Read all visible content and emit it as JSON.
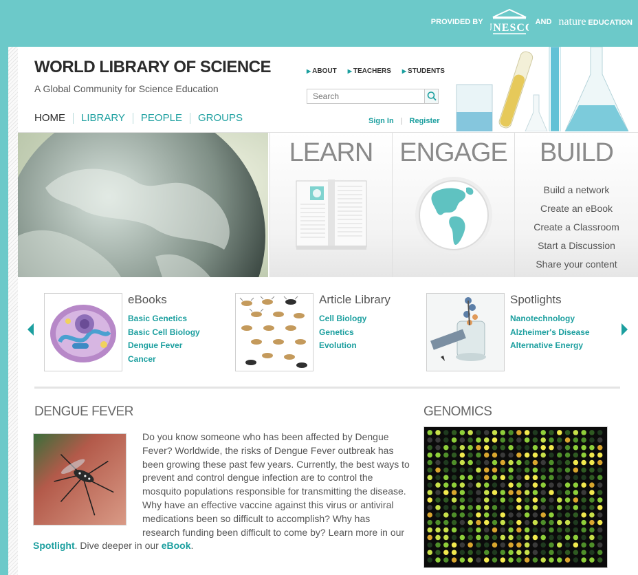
{
  "header": {
    "provided_by": "PROVIDED BY",
    "unesco": "UNESCO",
    "and": "AND",
    "nature": "nature",
    "education": "EDUCATION"
  },
  "site": {
    "title": "WORLD LIBRARY OF SCIENCE",
    "subtitle": "A Global Community for Science Education"
  },
  "nav": {
    "main": [
      "HOME",
      "LIBRARY",
      "PEOPLE",
      "GROUPS"
    ],
    "utility": [
      "ABOUT",
      "TEACHERS",
      "STUDENTS"
    ]
  },
  "search": {
    "placeholder": "Search"
  },
  "auth": {
    "sign_in": "Sign In",
    "register": "Register"
  },
  "hero": {
    "learn": "LEARN",
    "engage": "ENGAGE",
    "build": "BUILD",
    "build_items": [
      "Build a network",
      "Create an eBook",
      "Create a Classroom",
      "Start a Discussion",
      "Share your content"
    ]
  },
  "carousel": {
    "ebooks": {
      "title": "eBooks",
      "items": [
        "Basic Genetics",
        "Basic Cell Biology",
        "Dengue Fever",
        "Cancer"
      ]
    },
    "articles": {
      "title": "Article Library",
      "items": [
        "Cell Biology",
        "Genetics",
        "Evolution"
      ]
    },
    "spotlights": {
      "title": "Spotlights",
      "items": [
        "Nanotechnology",
        "Alzheimer's Disease",
        "Alternative Energy"
      ]
    }
  },
  "dengue": {
    "title": "DENGUE FEVER",
    "text_1": "Do you know someone who has been affected by Dengue Fever? Worldwide, the risks of Dengue Fever outbreak has been growing these past few years. Currently, the best ways to prevent and control dengue infection are to control the mosquito populations responsible for transmitting the disease. Why have an effective vaccine against this virus or antiviral medications been so difficult to accomplish? Why has research funding been difficult to come by? Learn more in our ",
    "spotlight_link": "Spotlight",
    "text_2": ". Dive deeper in our ",
    "ebook_link": "eBook",
    "text_3": "."
  },
  "genomics": {
    "title": "GENOMICS"
  },
  "colors": {
    "accent": "#1c9f9f",
    "topbar": "#6cc9c9"
  }
}
